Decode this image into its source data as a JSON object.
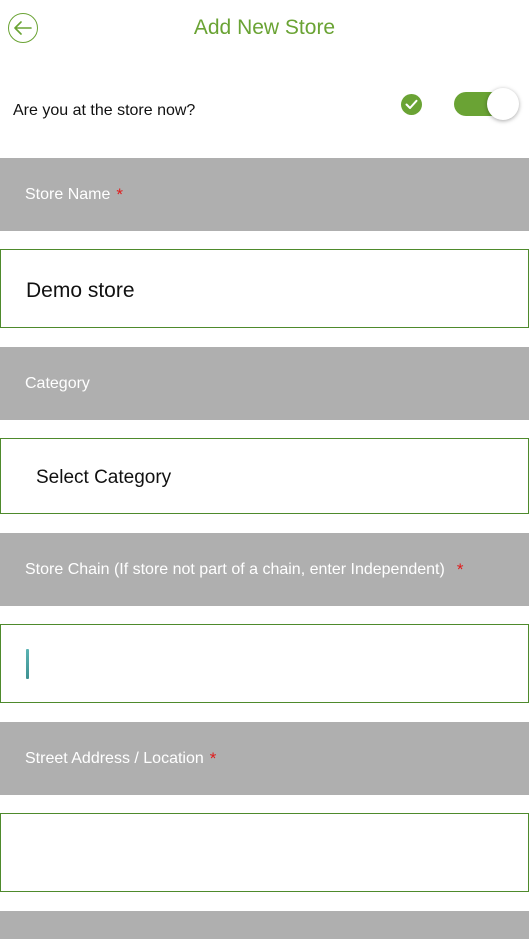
{
  "header": {
    "title": "Add New Store",
    "back_icon": "arrow-left-circle-icon"
  },
  "question": {
    "label": "Are you at the store now?",
    "check_icon": "check-circle-icon",
    "toggle_on": true
  },
  "fields": {
    "store_name": {
      "label": "Store Name",
      "required_mark": "*",
      "value": "Demo store"
    },
    "category": {
      "label": "Category",
      "value": "Select Category"
    },
    "store_chain": {
      "label": "Store Chain (If store not part of a chain, enter Independent)",
      "required_mark": "*",
      "value": ""
    },
    "street_address": {
      "label": "Street Address / Location",
      "required_mark": "*",
      "value": ""
    }
  },
  "colors": {
    "accent": "#6aa334",
    "label_bar": "#afafaf",
    "required": "#e01b1b",
    "field_border": "#4e8a2c"
  }
}
